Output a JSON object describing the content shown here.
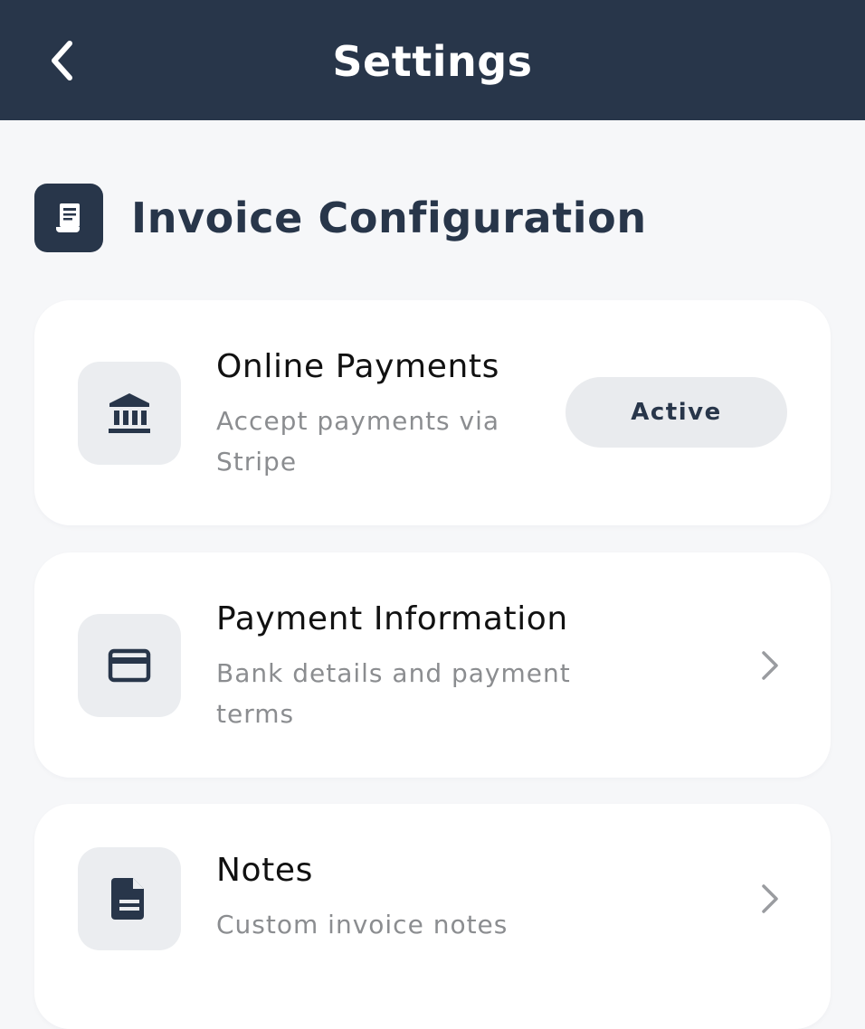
{
  "header": {
    "title": "Settings",
    "back_icon": "chevron-left-icon"
  },
  "section": {
    "title": "Invoice Configuration",
    "icon": "receipt-icon"
  },
  "items": [
    {
      "title": "Online Payments",
      "subtitle": "Accept payments via Stripe",
      "icon": "bank-icon",
      "status": "Active"
    },
    {
      "title": "Payment Information",
      "subtitle": "Bank details and payment terms",
      "icon": "credit-card-icon",
      "action_icon": "chevron-right-icon"
    },
    {
      "title": "Notes",
      "subtitle": "Custom invoice notes",
      "icon": "document-icon",
      "action_icon": "chevron-right-icon"
    }
  ],
  "colors": {
    "header_bg": "#28364a",
    "page_bg": "#f6f7f9",
    "card_bg": "#ffffff",
    "icon_tile_bg": "#ebedf0",
    "subtitle": "#8b8d90"
  }
}
